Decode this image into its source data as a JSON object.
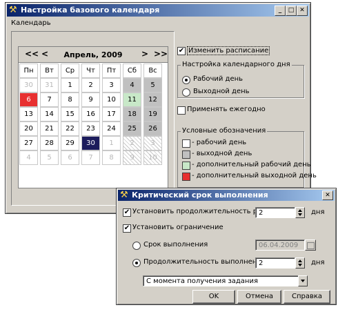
{
  "main_window": {
    "title": "Настройка базового календаря",
    "menu": [
      "Календарь"
    ]
  },
  "calendar": {
    "prev_year": "<<",
    "prev_month": "<",
    "month_label": "Апрель, 2009",
    "next_month": ">",
    "next_year": ">>",
    "weekdays": [
      "Пн",
      "Вт",
      "Ср",
      "Чт",
      "Пт",
      "Сб",
      "Вс"
    ],
    "weeks": [
      [
        {
          "d": "30",
          "k": "other"
        },
        {
          "d": "31",
          "k": "other"
        },
        {
          "d": "1",
          "k": ""
        },
        {
          "d": "2",
          "k": ""
        },
        {
          "d": "3",
          "k": ""
        },
        {
          "d": "4",
          "k": "gray"
        },
        {
          "d": "5",
          "k": "gray"
        }
      ],
      [
        {
          "d": "6",
          "k": "red"
        },
        {
          "d": "7",
          "k": ""
        },
        {
          "d": "8",
          "k": ""
        },
        {
          "d": "9",
          "k": ""
        },
        {
          "d": "10",
          "k": ""
        },
        {
          "d": "11",
          "k": "green"
        },
        {
          "d": "12",
          "k": "gray"
        }
      ],
      [
        {
          "d": "13",
          "k": ""
        },
        {
          "d": "14",
          "k": ""
        },
        {
          "d": "15",
          "k": ""
        },
        {
          "d": "16",
          "k": ""
        },
        {
          "d": "17",
          "k": ""
        },
        {
          "d": "18",
          "k": "gray"
        },
        {
          "d": "19",
          "k": "gray"
        }
      ],
      [
        {
          "d": "20",
          "k": ""
        },
        {
          "d": "21",
          "k": ""
        },
        {
          "d": "22",
          "k": ""
        },
        {
          "d": "23",
          "k": ""
        },
        {
          "d": "24",
          "k": ""
        },
        {
          "d": "25",
          "k": "gray"
        },
        {
          "d": "26",
          "k": "gray"
        }
      ],
      [
        {
          "d": "27",
          "k": ""
        },
        {
          "d": "28",
          "k": ""
        },
        {
          "d": "29",
          "k": ""
        },
        {
          "d": "30",
          "k": "sel"
        },
        {
          "d": "1",
          "k": "other"
        },
        {
          "d": "2",
          "k": "hatch"
        },
        {
          "d": "3",
          "k": "hatch"
        }
      ],
      [
        {
          "d": "4",
          "k": "other"
        },
        {
          "d": "5",
          "k": "other"
        },
        {
          "d": "6",
          "k": "other"
        },
        {
          "d": "7",
          "k": "other"
        },
        {
          "d": "8",
          "k": "other"
        },
        {
          "d": "9",
          "k": "hatch"
        },
        {
          "d": "10",
          "k": "hatch"
        }
      ]
    ]
  },
  "schedule": {
    "change_schedule_label": "Изменить расписание",
    "change_schedule_checked": true,
    "day_settings_title": "Настройка календарного дня",
    "work_day_label": "Рабочий день",
    "day_off_label": "Выходной день",
    "apply_yearly_label": "Применять ежегодно"
  },
  "legend": {
    "title": "Условные обозначения",
    "items": [
      {
        "label": "- рабочий день",
        "color": "#ffffff"
      },
      {
        "label": "- выходной день",
        "color": "#c0c0c0"
      },
      {
        "label": "- дополнительный рабочий день",
        "color": "#c8e8c8"
      },
      {
        "label": "- дополнительный выходной день",
        "color": "#e83030"
      }
    ]
  },
  "dialog": {
    "title": "Критический срок выполнения",
    "set_duration_label": "Установить продолжительность работ",
    "set_duration_value": "2",
    "days_unit": "дня",
    "set_constraint_label": "Установить ограничение",
    "deadline_label": "Срок выполнения",
    "deadline_value": "06.04.2009",
    "duration_label": "Продолжительность выполнения",
    "duration_value": "2",
    "from_select_value": "С момента получения задания",
    "ok_label": "OK",
    "cancel_label": "Отмена",
    "help_label": "Справка"
  }
}
